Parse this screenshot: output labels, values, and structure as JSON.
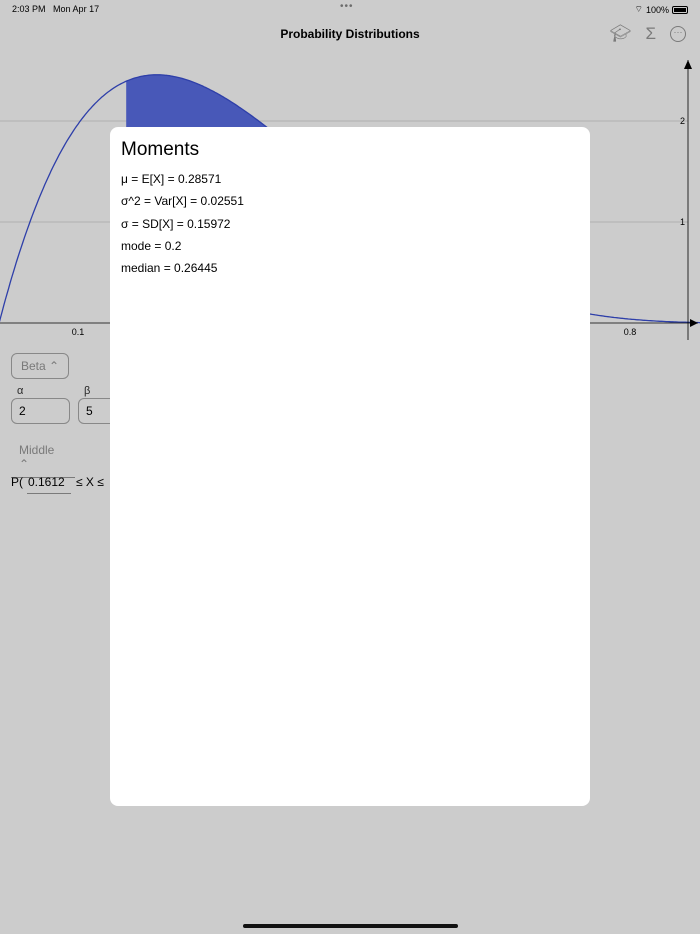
{
  "status": {
    "time": "2:03 PM",
    "date": "Mon Apr 17",
    "battery": "100%"
  },
  "nav": {
    "title": "Probability Distributions",
    "icons": [
      "graduation-cap-icon",
      "sigma-icon",
      "more-icon"
    ],
    "sigma": "Σ",
    "more": "···"
  },
  "chart_data": {
    "type": "area",
    "distribution": "Beta",
    "alpha": 2,
    "beta": 5,
    "xlim": [
      0,
      0.9
    ],
    "ylim": [
      0,
      2.6
    ],
    "x_ticks": [
      "0.1",
      "0.8"
    ],
    "y_ticks": [
      "1",
      "2"
    ],
    "shaded_from": 0.1612,
    "colors": {
      "curve": "#3a4fd4",
      "fill": "#5a6ee6"
    }
  },
  "controls": {
    "distribution": "Beta",
    "alpha_label": "α",
    "alpha_value": "2",
    "beta_label": "β",
    "beta_value": "5",
    "mode": "Middle",
    "prob_prefix": "P(",
    "lower": "0.1612",
    "between": "≤ X ≤"
  },
  "modal": {
    "title": "Moments",
    "rows": [
      "μ = E[X] = 0.28571",
      "σ^2 = Var[X] = 0.02551",
      "σ = SD[X] = 0.15972",
      "mode = 0.2",
      "median = 0.26445"
    ]
  }
}
